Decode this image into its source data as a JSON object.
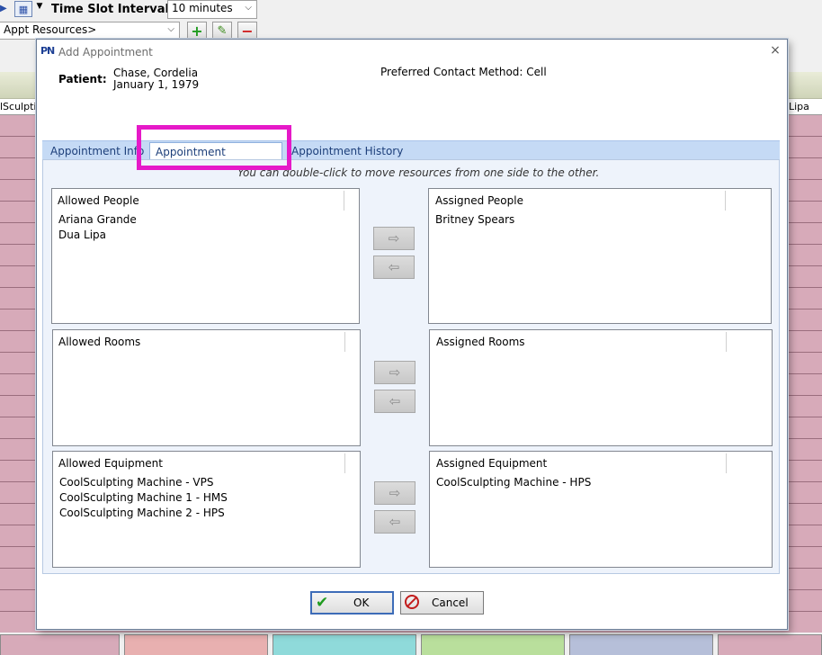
{
  "background": {
    "time_slot_label": "Time Slot Interval:",
    "time_slot_value": "10 minutes",
    "resources_combo": "Appt Resources>",
    "column_left": "lSculpti",
    "column_right": "Lipa",
    "add_icon": "plus-icon",
    "edit_icon": "pencil-icon",
    "remove_icon": "minus-icon",
    "grid_color": "#d7aab9"
  },
  "dialog": {
    "title": "Add Appointment",
    "logo": "PN",
    "close": "×",
    "patient_label": "Patient:",
    "patient_name": "Chase, Cordelia",
    "patient_dob": "January 1, 1979",
    "preferred_contact": "Preferred Contact Method: Cell",
    "tabs": [
      {
        "label": "Appointment Info"
      },
      {
        "label": "Appointment Resources"
      },
      {
        "label": "Appointment History"
      }
    ],
    "hint": "You can double-click to move resources from one side to the other.",
    "sections": [
      {
        "allowed_header": "Allowed People",
        "allowed_items": [
          "Ariana Grande",
          "Dua Lipa"
        ],
        "assigned_header": "Assigned People",
        "assigned_items": [
          "Britney Spears"
        ]
      },
      {
        "allowed_header": "Allowed Rooms",
        "allowed_items": [],
        "assigned_header": "Assigned Rooms",
        "assigned_items": []
      },
      {
        "allowed_header": "Allowed Equipment",
        "allowed_items": [
          "CoolSculpting Machine - VPS",
          "CoolSculpting Machine 1 - HMS",
          "CoolSculpting Machine 2 - HPS"
        ],
        "assigned_header": "Assigned Equipment",
        "assigned_items": [
          "CoolSculpting Machine - HPS"
        ]
      }
    ],
    "ok_label": "OK",
    "cancel_label": "Cancel",
    "accent_highlight": "#e619c8"
  }
}
